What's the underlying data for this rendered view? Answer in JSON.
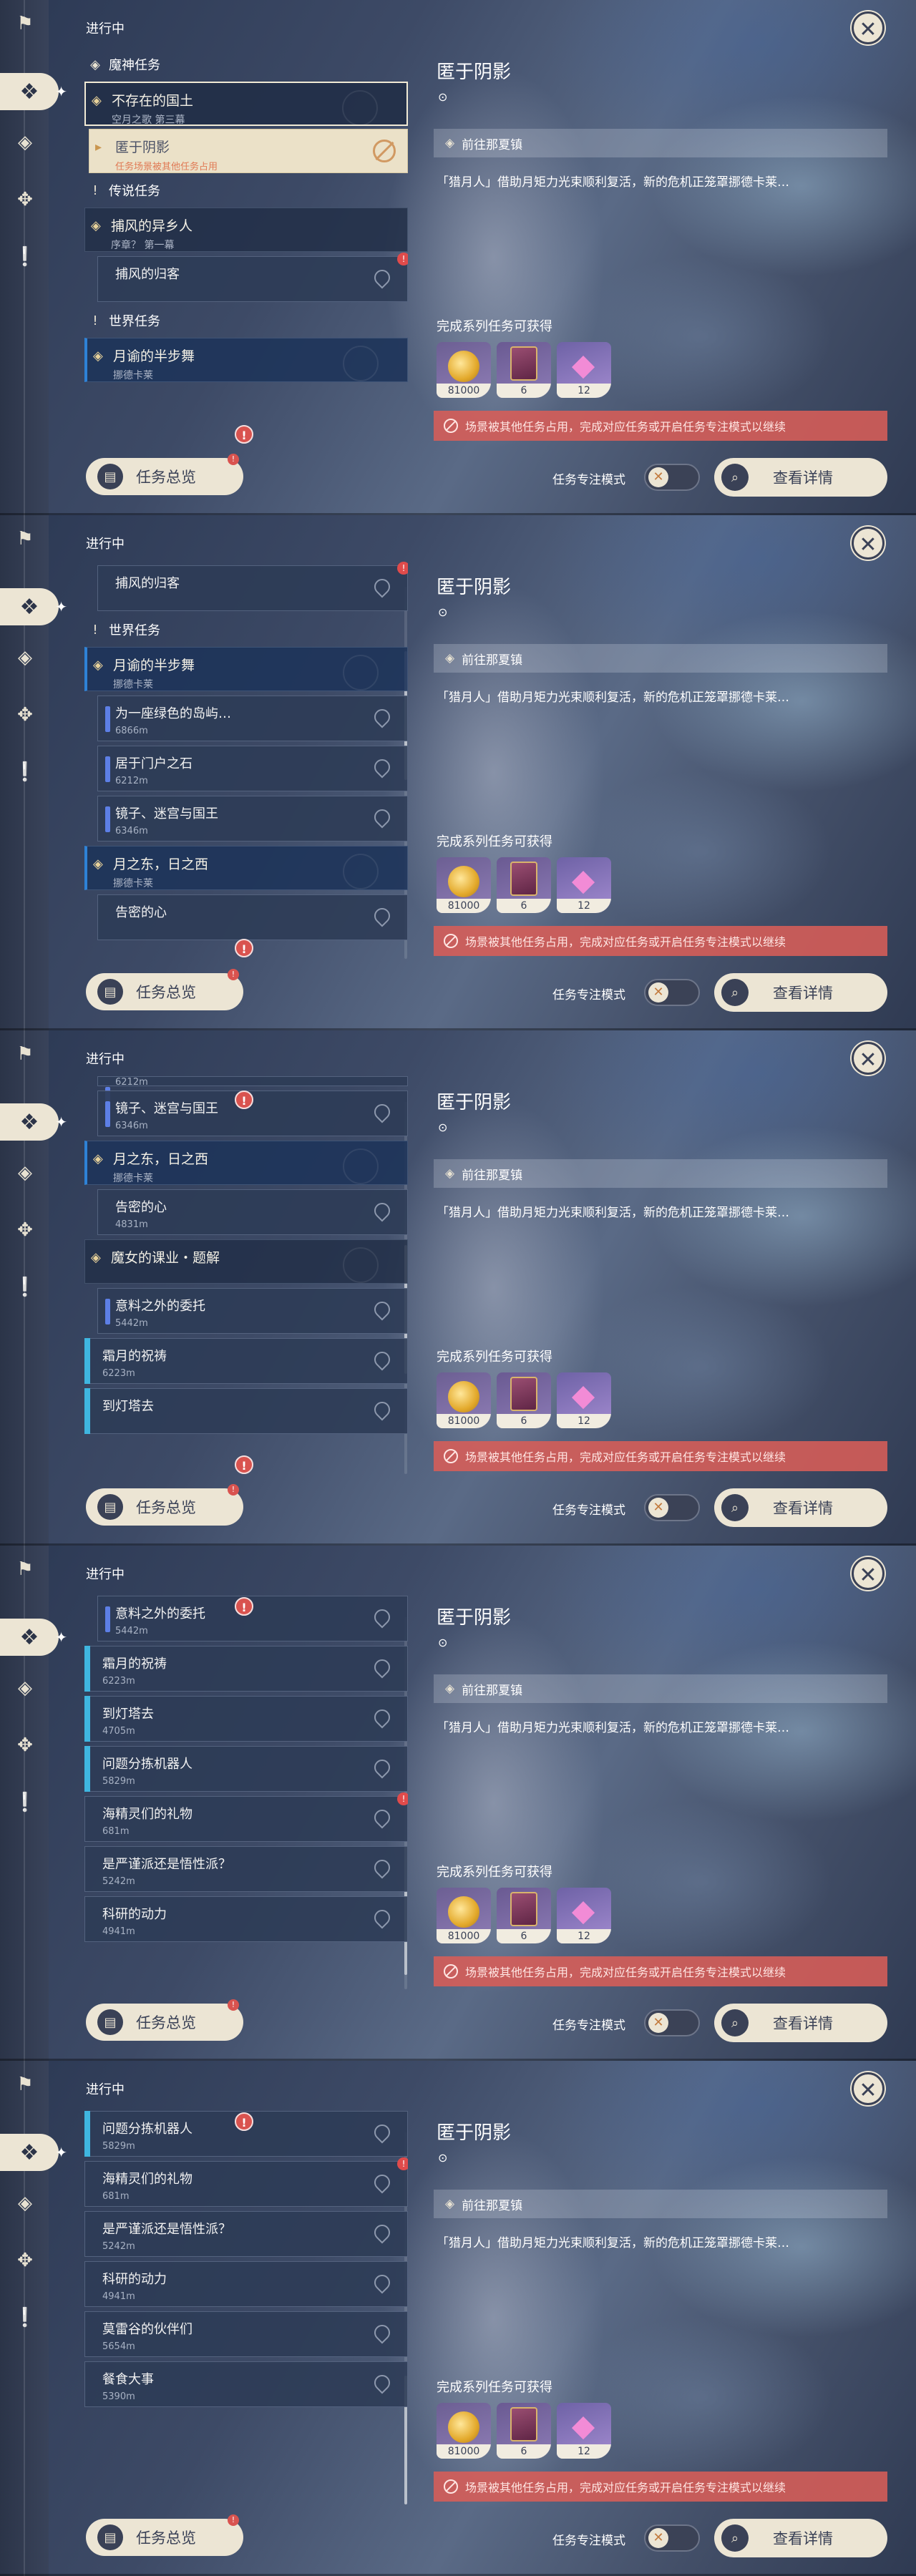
{
  "header_title": "进行中",
  "close_label": "✕",
  "categories": {
    "archon": "魔神任务",
    "legend": "传说任务",
    "world": "世界任务"
  },
  "quests": {
    "q1": {
      "title": "不存在的国土",
      "sub": "空月之歌 第三幕"
    },
    "q2": {
      "title": "匿于阴影",
      "sub": "任务场景被其他任务占用"
    },
    "q3": {
      "title": "捕风的异乡人",
      "sub": "序章？ 第一幕"
    },
    "q4": {
      "title": "月谕的半步舞",
      "sub": "挪德卡莱"
    },
    "q5": {
      "title": "月之东，日之西",
      "sub": "挪德卡莱"
    },
    "q6": {
      "title": "魔女的课业・题解"
    }
  },
  "subs": {
    "s1": {
      "title": "捕风的归客"
    },
    "s2": {
      "title": "为一座绿色的岛屿…",
      "dist": "6866m"
    },
    "s3": {
      "title": "居于门户之石",
      "dist": "6212m"
    },
    "s4": {
      "title": "镜子、迷宫与国王",
      "dist": "6346m"
    },
    "s5": {
      "title": "告密的心",
      "dist": "4831m"
    },
    "s6": {
      "title": "意料之外的委托",
      "dist": "5442m"
    },
    "s7": {
      "title": "霜月的祝祷",
      "dist": "6223m"
    },
    "s8": {
      "title": "到灯塔去",
      "dist": "4705m"
    },
    "s9": {
      "title": "问题分拣机器人",
      "dist": "5829m"
    },
    "s10": {
      "title": "海精灵们的礼物",
      "dist": "681m"
    },
    "s11": {
      "title": "是严谨派还是悟性派？",
      "dist": "5242m"
    },
    "s12": {
      "title": "科研的动力",
      "dist": "4941m"
    },
    "s13": {
      "title": "莫雷谷的伙伴们",
      "dist": "5654m"
    },
    "s14": {
      "title": "餐食大事",
      "dist": "5390m"
    },
    "s15": {
      "dist": "6212m"
    },
    "s16": {
      "title": "告密的心"
    },
    "s17": {
      "title": "到灯塔去"
    }
  },
  "detail": {
    "title": "匿于阴影",
    "objective": "前往那夏镇",
    "description": "「猎月人」借助月矩力光束顺利复活，新的危机正笼罩挪德卡莱…",
    "reward_title": "完成系列任务可获得",
    "rewards": [
      {
        "icon": "mora-coin-icon",
        "count": "81000"
      },
      {
        "icon": "book-icon",
        "count": "6"
      },
      {
        "icon": "crystal-icon",
        "count": "12"
      }
    ],
    "warning": "场景被其他任务占用，完成对应任务或开启任务专注模式以继续"
  },
  "bottom": {
    "overview_label": "任务总览",
    "focus_label": "任务专注模式",
    "detail_label": "查看详情"
  }
}
